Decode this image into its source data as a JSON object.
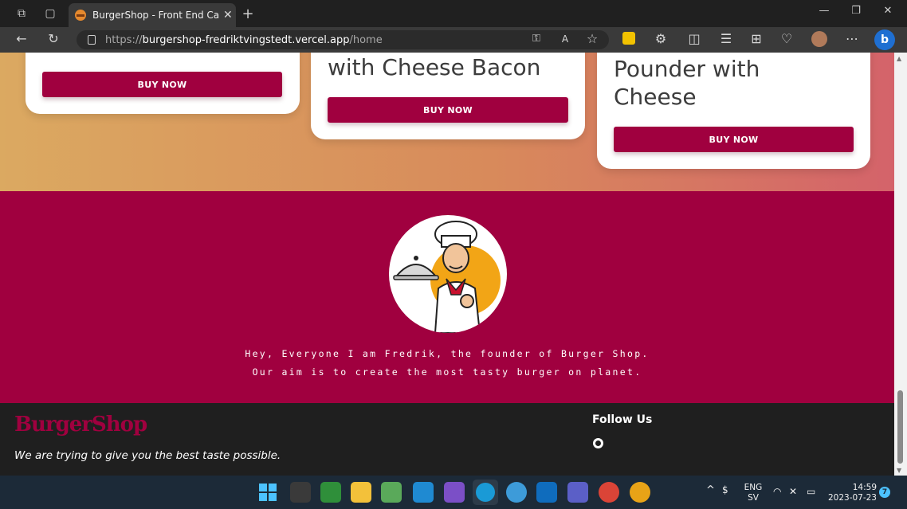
{
  "browser": {
    "tab_title": "BurgerShop - Front End Capston",
    "url_prefix": "https://",
    "url_domain": "burgershop-fredriktvingstedt.vercel.app",
    "url_path": "/home"
  },
  "cards": [
    {
      "title_lines": [],
      "button": "BUY NOW"
    },
    {
      "title_lines": [
        "with Cheese Bacon"
      ],
      "button": "BUY NOW"
    },
    {
      "title_lines": [
        "Pounder with",
        "Cheese"
      ],
      "button": "BUY NOW"
    }
  ],
  "about": {
    "line1": "Hey, Everyone I am Fredrik, the founder of Burger Shop.",
    "line2": "Our aim is to create the most tasty burger on planet."
  },
  "footer": {
    "brand": "BurgerShop",
    "tagline": "We are trying to give you the best taste possible.",
    "follow_title": "Follow Us"
  },
  "taskbar": {
    "lang_top": "ENG",
    "lang_bottom": "SV",
    "time": "14:59",
    "date": "2023-07-23",
    "notifications": "7"
  },
  "colors": {
    "accent": "#a0003f",
    "footer_bg": "#1f1f1f"
  }
}
